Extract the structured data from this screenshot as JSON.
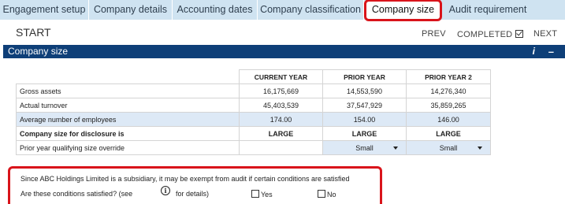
{
  "tabs": [
    {
      "label": "Engagement setup",
      "active": false
    },
    {
      "label": "Company details",
      "active": false
    },
    {
      "label": "Accounting dates",
      "active": false
    },
    {
      "label": "Company classification",
      "active": false
    },
    {
      "label": "Company size",
      "active": true
    },
    {
      "label": "Audit requirement",
      "active": false
    }
  ],
  "nav": {
    "start": "START",
    "prev": "PREV",
    "completed": "COMPLETED",
    "next": "NEXT"
  },
  "section": {
    "title": "Company size",
    "info_glyph": "i",
    "minimize_glyph": "–"
  },
  "table": {
    "columns": [
      "CURRENT YEAR",
      "PRIOR YEAR",
      "PRIOR YEAR 2"
    ],
    "rows": [
      {
        "label": "Gross assets",
        "values": [
          "16,175,669",
          "14,553,590",
          "14,276,340"
        ]
      },
      {
        "label": "Actual turnover",
        "values": [
          "45,403,539",
          "37,547,929",
          "35,859,265"
        ]
      },
      {
        "label": "Average number of employees",
        "values": [
          "174.00",
          "154.00",
          "146.00"
        ]
      },
      {
        "label": "Company size for disclosure is",
        "values": [
          "LARGE",
          "LARGE",
          "LARGE"
        ]
      },
      {
        "label": "Prior year qualifying size override",
        "values": [
          "",
          "Small",
          "Small"
        ]
      }
    ]
  },
  "exemption": {
    "statement": "Since ABC Holdings Limited is a subsidiary, it may be exempt from audit if certain conditions are satisfied",
    "question": "Are these conditions satisfied? (see",
    "info_glyph": "i",
    "details": "for details)",
    "yes_label": "Yes",
    "no_label": "No"
  },
  "colors": {
    "accent_red": "#d9141b",
    "header_navy": "#0e3f78",
    "tab_blue": "#cfe3f1",
    "cell_shade": "#dde9f6"
  }
}
